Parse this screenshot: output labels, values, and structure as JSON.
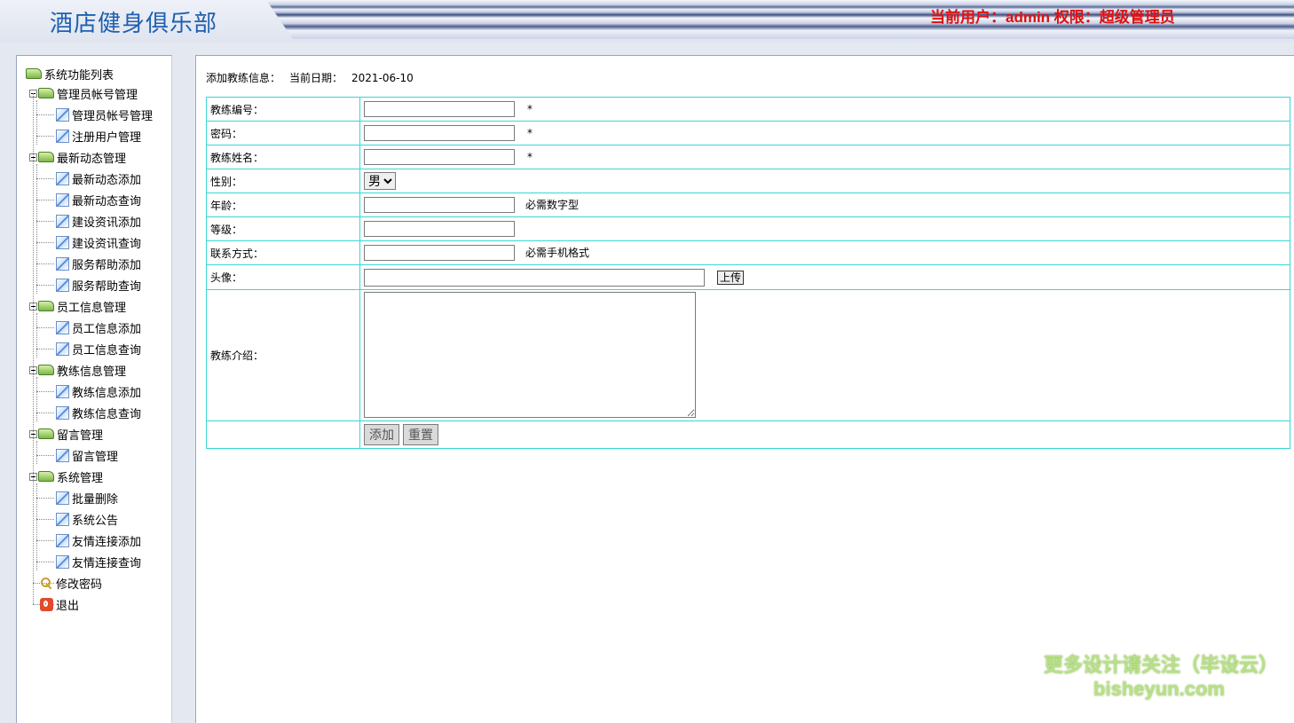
{
  "header": {
    "title": "酒店健身俱乐部",
    "user_info": "当前用户：admin  权限：超级管理员"
  },
  "sidebar": {
    "root": "系统功能列表",
    "groups": [
      {
        "label": "管理员帐号管理",
        "items": [
          "管理员帐号管理",
          "注册用户管理"
        ]
      },
      {
        "label": "最新动态管理",
        "items": [
          "最新动态添加",
          "最新动态查询",
          "建设资讯添加",
          "建设资讯查询",
          "服务帮助添加",
          "服务帮助查询"
        ]
      },
      {
        "label": "员工信息管理",
        "items": [
          "员工信息添加",
          "员工信息查询"
        ]
      },
      {
        "label": "教练信息管理",
        "items": [
          "教练信息添加",
          "教练信息查询"
        ]
      },
      {
        "label": "留言管理",
        "items": [
          "留言管理"
        ]
      },
      {
        "label": "系统管理",
        "items": [
          "批量删除",
          "系统公告",
          "友情连接添加",
          "友情连接查询"
        ]
      }
    ],
    "change_password": "修改密码",
    "logout": "退出",
    "icons": {
      "group": "folder-icon",
      "item": "pencil-icon",
      "change_password": "key-icon",
      "logout": "exit-icon"
    }
  },
  "main": {
    "heading": "添加教练信息：",
    "date_label": "当前日期：",
    "date_value": "2021-06-10",
    "fields": {
      "coach_id": {
        "label": "教练编号：",
        "value": "",
        "mark": "*"
      },
      "password": {
        "label": "密码：",
        "value": "",
        "mark": "*"
      },
      "coach_name": {
        "label": "教练姓名：",
        "value": "",
        "mark": "*"
      },
      "gender": {
        "label": "性别：",
        "selected": "男"
      },
      "age": {
        "label": "年龄：",
        "value": "",
        "note": "必需数字型"
      },
      "level": {
        "label": "等级：",
        "value": ""
      },
      "contact": {
        "label": "联系方式：",
        "value": "",
        "note": "必需手机格式"
      },
      "avatar": {
        "label": "头像：",
        "value": "",
        "upload": "上传"
      },
      "intro": {
        "label": "教练介绍：",
        "value": ""
      }
    },
    "buttons": {
      "add": "添加",
      "reset": "重置"
    }
  },
  "watermark": {
    "line1": "更多设计请关注（毕设云）",
    "line2": "bisheyun.com"
  }
}
